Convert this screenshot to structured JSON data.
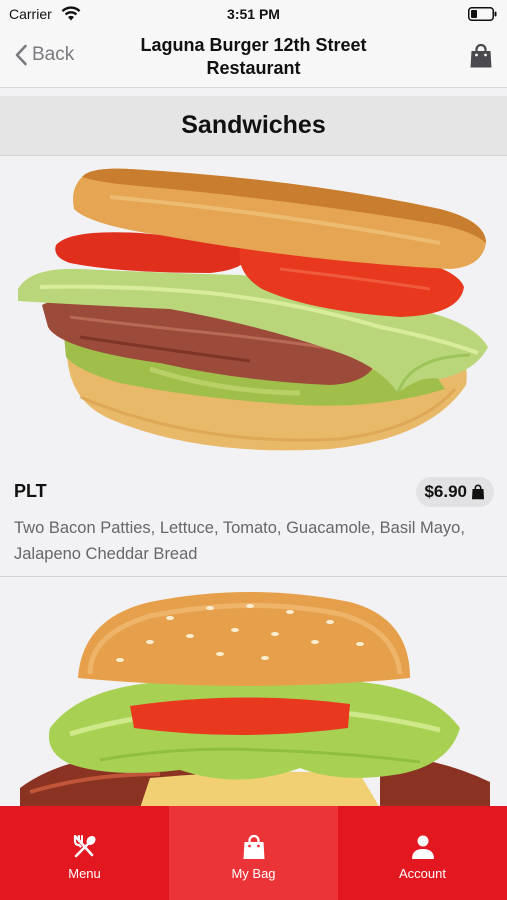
{
  "status_bar": {
    "carrier": "Carrier",
    "time": "3:51 PM"
  },
  "nav": {
    "back_label": "Back",
    "title_line1": "Laguna Burger 12th Street",
    "title_line2": "Restaurant"
  },
  "section": {
    "title": "Sandwiches"
  },
  "items": [
    {
      "name": "PLT",
      "price": "$6.90",
      "description": "Two Bacon Patties, Lettuce, Tomato, Guacamole, Basil Mayo, Jalapeno Cheddar Bread"
    },
    {
      "name": "",
      "price": "",
      "description": ""
    }
  ],
  "tabs": [
    {
      "label": "Menu",
      "icon": "fork-spoon-icon"
    },
    {
      "label": "My Bag",
      "icon": "shopping-bag-icon"
    },
    {
      "label": "Account",
      "icon": "person-icon"
    }
  ],
  "colors": {
    "tab_bar": "#e2171f",
    "tab_active": "#ea3438",
    "nav_gray": "#7a7a7e"
  }
}
